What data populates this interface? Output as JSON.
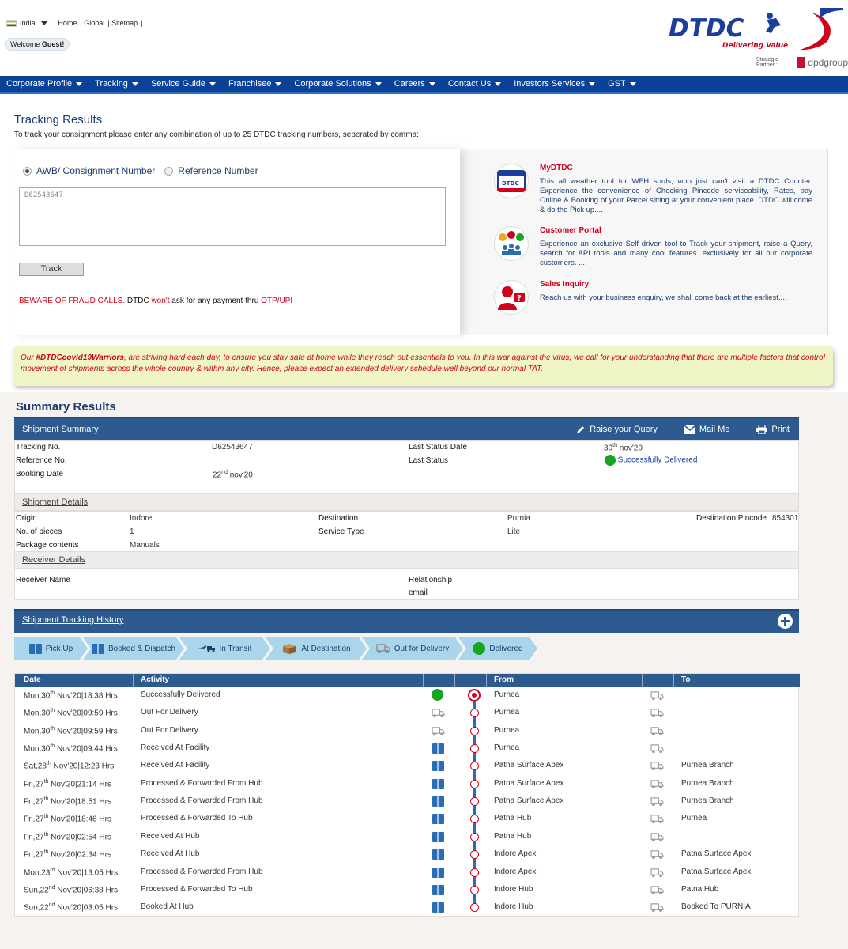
{
  "header": {
    "country": "India",
    "links": [
      "| Home",
      "| Global",
      "| Sitemap",
      "|"
    ],
    "welcome_prefix": "Welcome ",
    "welcome_user": "Guest!",
    "logo_text": "DTDC",
    "tagline": "Delivering Value",
    "partner_label": "Strategic Partner :",
    "partner_name": "dpdgroup"
  },
  "nav": [
    "Corporate Profile",
    "Tracking",
    "Service Guide",
    "Franchisee",
    "Corporate Solutions",
    "Careers",
    "Contact Us",
    "Investors Services",
    "GST"
  ],
  "tracking": {
    "title": "Tracking Results",
    "description": "To track your consignment please enter any combination of up to 25 DTDC tracking numbers, seperated by comma:",
    "radio_awb": "AWB/ Consignment Number",
    "radio_ref": "Reference Number",
    "input_value": "D62543647",
    "track_button": "Track",
    "fraud_red1": "BEWARE OF FRAUD CALLS.",
    "fraud_mid1": " DTDC ",
    "fraud_red2": "won't",
    "fraud_mid2": " ask for any payment thru ",
    "fraud_red3": "OTP/UPI"
  },
  "promos": [
    {
      "title": "MyDTDC",
      "text": "This all weather tool for WFH souls, who just can't visit a DTDC Counter. Experience the convenience of Checking Pincode serviceability, Rates, pay Online & Booking of your Parcel sitting at your convenient place. DTDC will come & do the Pick up....",
      "icon": "mydtdc-app-icon"
    },
    {
      "title": "Customer Portal",
      "text": "Experience an exclusive Self driven tool to Track your shipment, raise a Query, search for API tools and many cool features. exclusively for all our corporate customers. ...",
      "icon": "customer-portal-icon"
    },
    {
      "title": "Sales Inquiry",
      "text": "Reach us with your business enquiry, we shall come back at the earliest....",
      "icon": "sales-inquiry-icon"
    }
  ],
  "covid": {
    "prefix": "Our ",
    "hashtag": "#DTDCcovid19Warriors",
    "text": ", are striving hard each day, to ensure you stay safe at home while they reach out essentials to you. In this war against the virus, we call for your understanding that there are multiple factors that control movement of shipments across the whole country & within any city. Hence, please expect an extended delivery schedule well beyond our normal TAT."
  },
  "summary": {
    "title": "Summary Results",
    "bar_title": "Shipment Summary",
    "raise_query": "Raise your Query",
    "mail_me": "Mail Me",
    "print": "Print",
    "tracking_no_label": "Tracking No.",
    "tracking_no": "D62543647",
    "reference_label": "Reference No.",
    "booking_label": "Booking Date",
    "booking_date_pre": "22",
    "booking_date_sup": "nd",
    "booking_date_post": " nov'20",
    "last_status_date_label": "Last Status Date",
    "last_status_date_pre": "30",
    "last_status_date_sup": "th",
    "last_status_date_post": " nov'20",
    "last_status_label": "Last Status",
    "last_status": "Successfully Delivered",
    "status_color": "#16a51e"
  },
  "shipment_details": {
    "title": "Shipment Details",
    "origin_label": "Origin",
    "origin": "Indore",
    "pieces_label": "No. of pieces",
    "pieces": "1",
    "contents_label": "Package contents",
    "contents": "Manuals",
    "destination_label": "Destination",
    "destination": "Purnia",
    "service_label": "Service Type",
    "service": "Lite",
    "pincode_label": "Destination Pincode",
    "pincode": "854301"
  },
  "receiver": {
    "title": "Receiver Details",
    "name_label": "Receiver Name",
    "relationship_label": "Relationship",
    "email_label": "email"
  },
  "history": {
    "title": "Shipment Tracking History",
    "steps": [
      "Pick Up",
      "Booked & Dispatch",
      "In Transit",
      "At Destination",
      "Out for Delivery",
      "Delivered"
    ],
    "columns": [
      "Date",
      "Activity",
      "From",
      "To"
    ],
    "rows": [
      {
        "day": "Mon,30",
        "sup": "th",
        "rest": " Nov'20|18:38 Hrs",
        "activity": "Successfully Delivered",
        "icon": "delivered",
        "from": "Purnea",
        "to": ""
      },
      {
        "day": "Mon,30",
        "sup": "th",
        "rest": " Nov'20|09:59 Hrs",
        "activity": "Out For Delivery",
        "icon": "van",
        "from": "Purnea",
        "to": ""
      },
      {
        "day": "Mon,30",
        "sup": "th",
        "rest": " Nov'20|09:59 Hrs",
        "activity": "Out For Delivery",
        "icon": "van",
        "from": "Purnea",
        "to": ""
      },
      {
        "day": "Mon,30",
        "sup": "th",
        "rest": " Nov'20|09:44 Hrs",
        "activity": "Received At Facility",
        "icon": "box",
        "from": "Purnea",
        "to": ""
      },
      {
        "day": "Sat,28",
        "sup": "th",
        "rest": " Nov'20|12:23 Hrs",
        "activity": "Received At Facility",
        "icon": "box",
        "from": "Patna Surface Apex",
        "to": "Purnea Branch"
      },
      {
        "day": "Fri,27",
        "sup": "th",
        "rest": " Nov'20|21:14 Hrs",
        "activity": "Processed & Forwarded From Hub",
        "icon": "box",
        "from": "Patna Surface Apex",
        "to": "Purnea Branch"
      },
      {
        "day": "Fri,27",
        "sup": "th",
        "rest": " Nov'20|18:51 Hrs",
        "activity": "Processed & Forwarded From Hub",
        "icon": "box",
        "from": "Patna Surface Apex",
        "to": "Purnea Branch"
      },
      {
        "day": "Fri,27",
        "sup": "th",
        "rest": " Nov'20|18:46 Hrs",
        "activity": "Processed & Forwarded To Hub",
        "icon": "box",
        "from": "Patna Hub",
        "to": "Purnea"
      },
      {
        "day": "Fri,27",
        "sup": "th",
        "rest": " Nov'20|02:54 Hrs",
        "activity": "Received At Hub",
        "icon": "box",
        "from": "Patna Hub",
        "to": ""
      },
      {
        "day": "Fri,27",
        "sup": "th",
        "rest": " Nov'20|02:34 Hrs",
        "activity": "Received At Hub",
        "icon": "box",
        "from": "Indore Apex",
        "to": "Patna Surface Apex"
      },
      {
        "day": "Mon,23",
        "sup": "rd",
        "rest": " Nov'20|13:05 Hrs",
        "activity": "Processed & Forwarded From Hub",
        "icon": "box",
        "from": "Indore Apex",
        "to": "Patna Surface Apex"
      },
      {
        "day": "Sun,22",
        "sup": "nd",
        "rest": " Nov'20|06:38 Hrs",
        "activity": "Processed & Forwarded To Hub",
        "icon": "box",
        "from": "Indore Hub",
        "to": "Patna Hub"
      },
      {
        "day": "Sun,22",
        "sup": "nd",
        "rest": " Nov'20|03:05 Hrs",
        "activity": "Booked At Hub",
        "icon": "box",
        "from": "Indore Hub",
        "to": "Booked To PURNIA"
      }
    ]
  },
  "colors": {
    "nav": "#0b4196",
    "bar": "#2d5b8f",
    "red": "#d0021b",
    "green": "#16a51e",
    "step": "#a9d6ea"
  }
}
